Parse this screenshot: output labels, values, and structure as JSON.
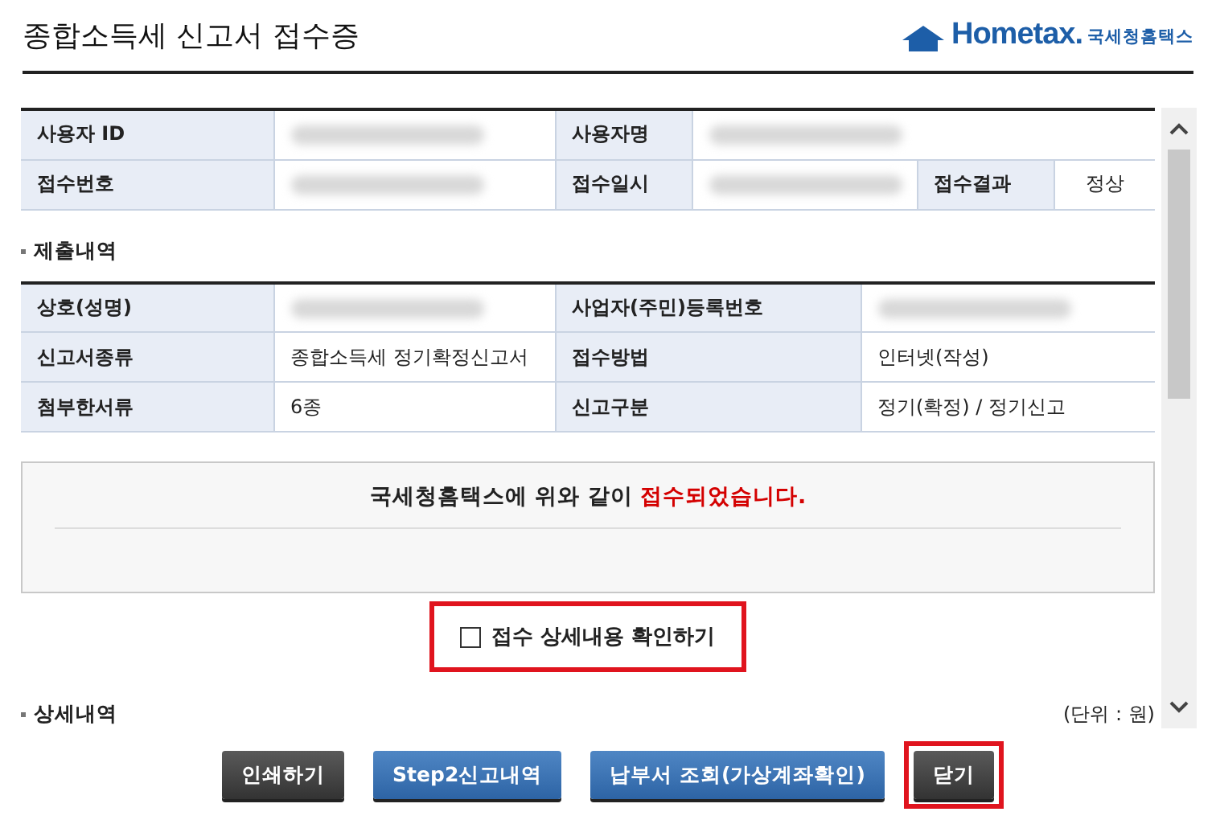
{
  "title": "종합소득세 신고서 접수증",
  "logo": {
    "brand": "Hometax.",
    "name": "국세청홈택스"
  },
  "user_table": {
    "rows": [
      [
        {
          "kind": "label",
          "text": "사용자 ID"
        },
        {
          "kind": "masked"
        },
        {
          "kind": "label",
          "text": "사용자명"
        },
        {
          "kind": "masked"
        }
      ],
      [
        {
          "kind": "label",
          "text": "접수번호"
        },
        {
          "kind": "masked"
        },
        {
          "kind": "label",
          "text": "접수일시"
        },
        {
          "kind": "masked"
        },
        {
          "kind": "label",
          "text": "접수결과"
        },
        {
          "kind": "value",
          "text": "정상"
        }
      ]
    ]
  },
  "submission": {
    "title": "제출내역",
    "rows": [
      [
        {
          "kind": "label",
          "text": "상호(성명)"
        },
        {
          "kind": "masked"
        },
        {
          "kind": "label",
          "text": "사업자(주민)등록번호"
        },
        {
          "kind": "masked"
        }
      ],
      [
        {
          "kind": "label",
          "text": "신고서종류"
        },
        {
          "kind": "value",
          "text": "종합소득세 정기확정신고서"
        },
        {
          "kind": "label",
          "text": "접수방법"
        },
        {
          "kind": "value",
          "text": "인터넷(작성)"
        }
      ],
      [
        {
          "kind": "label",
          "text": "첨부한서류"
        },
        {
          "kind": "value",
          "text": "6종"
        },
        {
          "kind": "label",
          "text": "신고구분"
        },
        {
          "kind": "value",
          "text": "정기(확정) / 정기신고"
        }
      ]
    ]
  },
  "message": {
    "text": "국세청홈택스에 위와 같이 ",
    "highlight": "접수되었습니다."
  },
  "detail_checkbox": {
    "label": "접수 상세내용 확인하기",
    "checked": false,
    "highlighted": true
  },
  "details": {
    "title": "상세내역",
    "unit": "(단위 : 원)"
  },
  "buttons": [
    {
      "label": "인쇄하기",
      "kind": "dark",
      "highlighted": false
    },
    {
      "label": "Step2신고내역",
      "kind": "blue",
      "highlighted": false
    },
    {
      "label": "납부서 조회(가상계좌확인)",
      "kind": "blue",
      "highlighted": false
    },
    {
      "label": "닫기",
      "kind": "dark",
      "highlighted": true
    }
  ]
}
